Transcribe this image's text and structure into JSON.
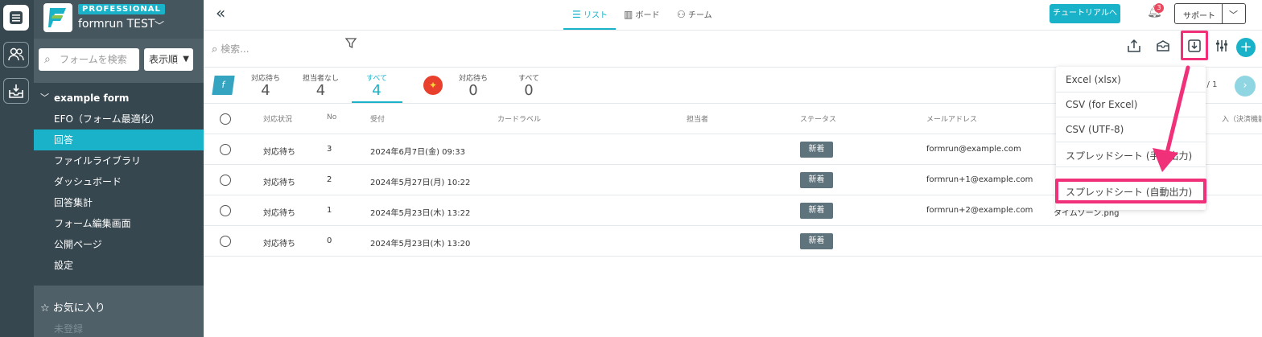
{
  "app": {
    "plan_badge": "PROFESSIONAL",
    "org_name": "formrun TEST",
    "colors": {
      "accent": "#1ab2c8",
      "sidebar": "#4f6069",
      "rail": "#37474f",
      "highlight": "#f1307a"
    }
  },
  "sidebar": {
    "search_placeholder": "フォームを検索",
    "sort_label": "表示順",
    "form_title": "example form",
    "items": [
      {
        "label": "EFO（フォーム最適化）",
        "active": false
      },
      {
        "label": "回答",
        "active": true
      },
      {
        "label": "ファイルライブラリ",
        "active": false
      },
      {
        "label": "ダッシュボード",
        "active": false
      },
      {
        "label": "回答集計",
        "active": false
      },
      {
        "label": "フォーム編集画面",
        "active": false
      },
      {
        "label": "公開ページ",
        "active": false
      },
      {
        "label": "設定",
        "active": false
      }
    ],
    "favorites_label": "お気に入り",
    "unregistered_label": "未登録"
  },
  "topbar": {
    "tabs": [
      {
        "label": "リスト",
        "icon": "list-icon",
        "active": true
      },
      {
        "label": "ボード",
        "icon": "board-icon",
        "active": false
      },
      {
        "label": "チーム",
        "icon": "team-icon",
        "active": false
      }
    ],
    "tutorial_label": "チュートリアルへ",
    "notification_count": "3",
    "support_label": "サポート"
  },
  "toolbar": {
    "search_placeholder": "検索..."
  },
  "counts": {
    "form_group": [
      {
        "label": "対応待ち",
        "value": "4"
      },
      {
        "label": "担当者なし",
        "value": "4"
      },
      {
        "label": "すべて",
        "value": "4"
      }
    ],
    "other_group": [
      {
        "label": "対応待ち",
        "value": "0"
      },
      {
        "label": "すべて",
        "value": "0"
      }
    ],
    "pager": "1 / 1"
  },
  "table": {
    "headers": {
      "status": "対応状況",
      "no": "No",
      "received": "受付",
      "card_label": "カードラベル",
      "assignee": "担当者",
      "state": "ステータス",
      "email": "メールアドレス",
      "extra": "入（決済機能）合"
    },
    "rows": [
      {
        "status": "対応待ち",
        "no": "3",
        "received": "2024年6月7日(金) 09:33",
        "state": "新着",
        "email": "formrun@example.com",
        "file": ""
      },
      {
        "status": "対応待ち",
        "no": "2",
        "received": "2024年5月27日(月) 10:22",
        "state": "新着",
        "email": "formrun+1@example.com",
        "file": ""
      },
      {
        "status": "対応待ち",
        "no": "1",
        "received": "2024年5月23日(木) 13:22",
        "state": "新着",
        "email": "formrun+2@example.com",
        "file": "タイムゾーン.png"
      },
      {
        "status": "対応待ち",
        "no": "0",
        "received": "2024年5月23日(木) 13:20",
        "state": "新着",
        "email": "",
        "file": ""
      }
    ]
  },
  "download_menu": {
    "items": [
      "Excel (xlsx)",
      "CSV (for Excel)",
      "CSV (UTF-8)",
      "スプレッドシート (手動出力)",
      "スプレッドシート (自動出力)"
    ]
  }
}
